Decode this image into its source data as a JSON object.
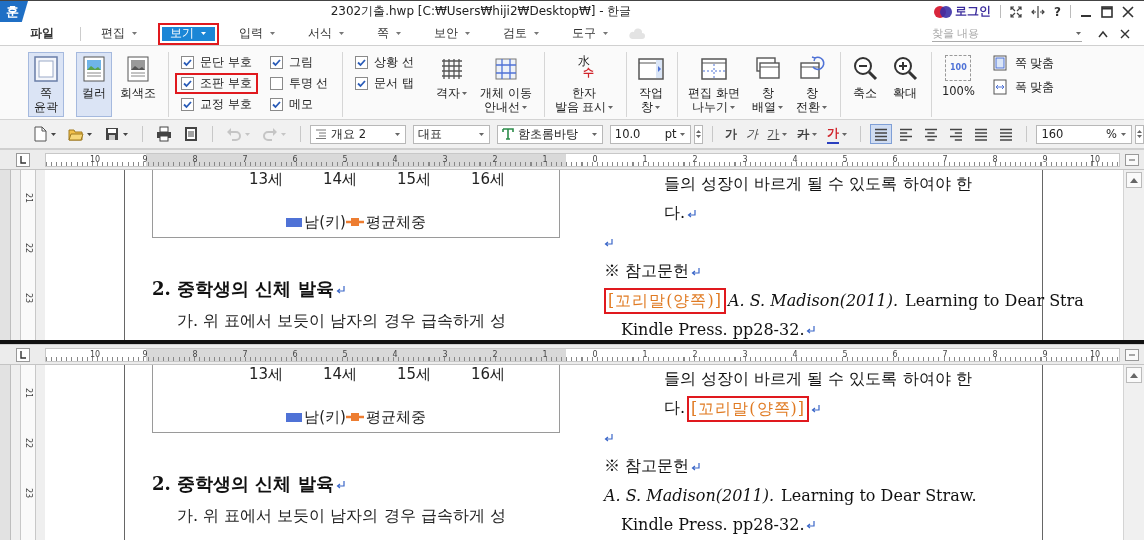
{
  "titlebar": {
    "logo": "훈",
    "title": "2302기출.hwp [C:₩Users₩hiji2₩Desktop₩] - 한글",
    "login": "로그인",
    "help": "?"
  },
  "menu": {
    "items": [
      {
        "label": "파일",
        "selected": false,
        "highlighted": false,
        "dropdown": false
      },
      {
        "label": "편집",
        "selected": false,
        "highlighted": false,
        "dropdown": true
      },
      {
        "label": "보기",
        "selected": true,
        "highlighted": true,
        "dropdown": true
      },
      {
        "label": "입력",
        "selected": false,
        "highlighted": false,
        "dropdown": true
      },
      {
        "label": "서식",
        "selected": false,
        "highlighted": false,
        "dropdown": true
      },
      {
        "label": "쪽",
        "selected": false,
        "highlighted": false,
        "dropdown": true
      },
      {
        "label": "보안",
        "selected": false,
        "highlighted": false,
        "dropdown": true
      },
      {
        "label": "검토",
        "selected": false,
        "highlighted": false,
        "dropdown": true
      },
      {
        "label": "도구",
        "selected": false,
        "highlighted": false,
        "dropdown": true
      }
    ],
    "search": {
      "placeholder": "찾을 내용"
    }
  },
  "ribbon": {
    "groups": [
      {
        "kind": "buttons",
        "divider": false,
        "items": [
          {
            "label": "쪽\n윤곽",
            "pressed": true,
            "dropdown": false
          }
        ]
      },
      {
        "kind": "buttons",
        "divider": false,
        "items": [
          {
            "label": "컬러",
            "pressed": true,
            "dropdown": false
          },
          {
            "label": "회색조",
            "pressed": false,
            "dropdown": false
          }
        ]
      },
      {
        "kind": "checks",
        "divider": true,
        "items": [
          {
            "label": "문단 부호",
            "checked": true,
            "highlighted": false
          },
          {
            "label": "조판 부호",
            "checked": true,
            "highlighted": true
          },
          {
            "label": "교정 부호",
            "checked": true,
            "highlighted": false
          },
          {
            "label": "그림",
            "checked": true,
            "highlighted": false
          },
          {
            "label": "투명 선",
            "checked": false,
            "highlighted": false
          },
          {
            "label": "메모",
            "checked": true,
            "highlighted": false
          }
        ]
      },
      {
        "kind": "checks",
        "divider": true,
        "items": [
          {
            "label": "상황 선",
            "checked": true,
            "highlighted": false
          },
          {
            "label": "문서 탭",
            "checked": true,
            "highlighted": false
          }
        ]
      },
      {
        "kind": "buttons",
        "divider": false,
        "items": [
          {
            "label": "격자",
            "pressed": false,
            "dropdown": true
          },
          {
            "label": "개체 이동\n안내선",
            "pressed": false,
            "dropdown": true
          }
        ]
      },
      {
        "kind": "buttons",
        "divider": true,
        "items": [
          {
            "label": "한자\n발음 표시",
            "icon_glyphs": [
              "水",
              "수"
            ],
            "pressed": false,
            "dropdown": true
          }
        ]
      },
      {
        "kind": "buttons",
        "divider": true,
        "items": [
          {
            "label": "작업\n창",
            "pressed": false,
            "dropdown": true
          }
        ]
      },
      {
        "kind": "buttons",
        "divider": true,
        "items": [
          {
            "label": "편집 화면\n나누기",
            "pressed": false,
            "dropdown": true
          },
          {
            "label": "창\n배열",
            "pressed": false,
            "dropdown": true
          },
          {
            "label": "창\n전환",
            "pressed": false,
            "dropdown": true
          }
        ]
      },
      {
        "kind": "buttons",
        "divider": true,
        "items": [
          {
            "label": "축소",
            "pressed": false,
            "dropdown": false
          },
          {
            "label": "확대",
            "pressed": false,
            "dropdown": false
          }
        ]
      },
      {
        "kind": "buttons",
        "divider": true,
        "items": [
          {
            "label": "100%",
            "icon_text": "100",
            "pressed": false,
            "dropdown": false
          }
        ]
      },
      {
        "kind": "smalls",
        "divider": false,
        "items": [
          {
            "label": "쪽 맞춤"
          },
          {
            "label": "폭 맞춤"
          }
        ]
      }
    ]
  },
  "toolbar": {
    "icon_groups": [
      [
        {
          "dropdown": true,
          "disabled": false
        },
        {
          "dropdown": true,
          "disabled": false
        },
        {
          "dropdown": true,
          "disabled": false
        }
      ],
      [
        {
          "dropdown": false,
          "disabled": false
        },
        {
          "dropdown": false,
          "disabled": false
        }
      ],
      [
        {
          "dropdown": true,
          "disabled": true
        },
        {
          "dropdown": true,
          "disabled": true
        }
      ]
    ],
    "style": "개요 2",
    "style_name": "대표",
    "font": "함초롬바탕",
    "size": "10.0",
    "unit": "pt",
    "format_buttons": [
      {
        "label": "가",
        "kind": "bold"
      },
      {
        "label": "가",
        "kind": "italic"
      },
      {
        "label": "가",
        "kind": "underline"
      },
      {
        "label": "가",
        "kind": "strike"
      },
      {
        "label": "가",
        "kind": "color"
      }
    ],
    "aligns": [
      {
        "kind": "justify",
        "selected": true
      },
      {
        "kind": "left",
        "selected": false
      },
      {
        "kind": "center",
        "selected": false
      },
      {
        "kind": "right",
        "selected": false
      },
      {
        "kind": "distribute",
        "selected": false
      },
      {
        "kind": "divide",
        "selected": false
      }
    ],
    "zoom": "160",
    "zoom_unit": "%"
  },
  "views": [
    {
      "ruler": [
        "10",
        "9",
        "8",
        "7",
        "6",
        "5",
        "4",
        "3",
        "2",
        "1",
        "0",
        "1",
        "2",
        "3",
        "4",
        "5",
        "6",
        "7",
        "8",
        "9",
        "10"
      ],
      "vruler": [
        "21",
        "22",
        "23"
      ],
      "chart": {
        "categories": [
          "13세",
          "14세",
          "15세",
          "16세"
        ],
        "legend": [
          {
            "label": "남(키)",
            "kind": "bar",
            "color": "#4f72d6"
          },
          {
            "label": "평균체중",
            "kind": "line",
            "color": "#ed7d31"
          }
        ]
      },
      "heading": "2. 중학생의 신체 발육",
      "paragraph": "가. 위 표에서 보듯이 남자의 경우 급속하게 성",
      "lines": [
        {
          "kind": "continuation",
          "para_mark": false,
          "segments": [
            {
              "kind": "plain",
              "text": "들의 성장이 바르게 될 수 있도록 하여야 한"
            }
          ]
        },
        {
          "kind": "continuation",
          "para_mark": true,
          "segments": [
            {
              "kind": "plain",
              "text": "다."
            }
          ]
        },
        {
          "kind": "plain",
          "para_mark": true
        },
        {
          "kind": "plain",
          "para_mark": true,
          "segments": [
            {
              "kind": "plain",
              "text": "※ 참고문헌"
            }
          ]
        },
        {
          "kind": "plain",
          "para_mark": false,
          "segments": [
            {
              "kind": "field",
              "text": "[꼬리말(양쪽)]",
              "highlighted": true
            },
            {
              "kind": "italic",
              "text": "A. S. Madison(2011)."
            },
            {
              "kind": "plain",
              "text": " Learning to Dear Stra"
            }
          ]
        },
        {
          "kind": "wrapped",
          "para_mark": true,
          "segments": [
            {
              "kind": "plain",
              "text": "Kindle Press. pp28-32."
            }
          ]
        }
      ]
    },
    {
      "ruler": [
        "10",
        "9",
        "8",
        "7",
        "6",
        "5",
        "4",
        "3",
        "2",
        "1",
        "0",
        "1",
        "2",
        "3",
        "4",
        "5",
        "6",
        "7",
        "8",
        "9",
        "10"
      ],
      "vruler": [
        "21",
        "22",
        "23"
      ],
      "chart": {
        "categories": [
          "13세",
          "14세",
          "15세",
          "16세"
        ],
        "legend": [
          {
            "label": "남(키)",
            "kind": "bar",
            "color": "#4f72d6"
          },
          {
            "label": "평균체중",
            "kind": "line",
            "color": "#ed7d31"
          }
        ]
      },
      "heading": "2. 중학생의 신체 발육",
      "paragraph": "가. 위 표에서 보듯이 남자의 경우 급속하게 성",
      "lines": [
        {
          "kind": "continuation",
          "para_mark": false,
          "segments": [
            {
              "kind": "plain",
              "text": "들의 성장이 바르게 될 수 있도록 하여야 한"
            }
          ]
        },
        {
          "kind": "continuation",
          "para_mark": true,
          "segments": [
            {
              "kind": "plain",
              "text": "다."
            },
            {
              "kind": "field",
              "text": "[꼬리말(양쪽)]",
              "highlighted": true
            }
          ]
        },
        {
          "kind": "plain",
          "para_mark": true
        },
        {
          "kind": "plain",
          "para_mark": true,
          "segments": [
            {
              "kind": "plain",
              "text": "※ 참고문헌"
            }
          ]
        },
        {
          "kind": "plain",
          "para_mark": false,
          "segments": [
            {
              "kind": "italic",
              "text": "A. S. Madison(2011)."
            },
            {
              "kind": "plain",
              "text": " Learning to Dear Straw."
            }
          ]
        },
        {
          "kind": "wrapped",
          "para_mark": true,
          "segments": [
            {
              "kind": "plain",
              "text": "Kindle Press. pp28-32."
            }
          ]
        }
      ]
    }
  ]
}
